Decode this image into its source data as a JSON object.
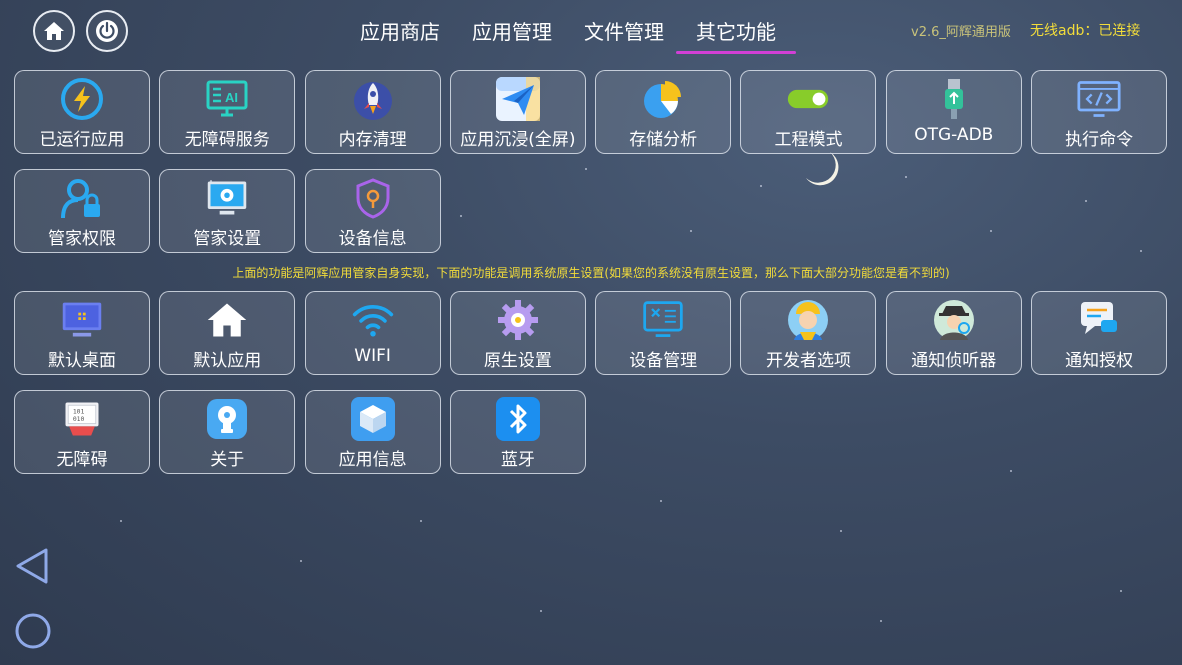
{
  "header": {
    "home_icon": "home-icon",
    "power_icon": "power-icon",
    "tabs": [
      {
        "label": "应用商店"
      },
      {
        "label": "应用管理"
      },
      {
        "label": "文件管理"
      },
      {
        "label": "其它功能",
        "active": true
      }
    ],
    "version": "v2.6_阿辉通用版",
    "adb_status": "无线adb：已连接"
  },
  "self_features": [
    {
      "label": "已运行应用",
      "icon": "lightning-icon"
    },
    {
      "label": "无障碍服务",
      "icon": "ai-monitor-icon"
    },
    {
      "label": "内存清理",
      "icon": "rocket-icon"
    },
    {
      "label": "应用沉浸(全屏)",
      "icon": "paper-plane-icon"
    },
    {
      "label": "存储分析",
      "icon": "pie-chart-icon"
    },
    {
      "label": "工程模式",
      "icon": "toggle-icon"
    },
    {
      "label": "OTG-ADB",
      "icon": "usb-icon"
    },
    {
      "label": "执行命令",
      "icon": "code-icon"
    },
    {
      "label": "管家权限",
      "icon": "user-lock-icon"
    },
    {
      "label": "管家设置",
      "icon": "monitor-gear-icon"
    },
    {
      "label": "设备信息",
      "icon": "shield-pin-icon"
    }
  ],
  "notice": "上面的功能是阿辉应用管家自身实现，下面的功能是调用系统原生设置(如果您的系统没有原生设置，那么下面大部分功能您是看不到的)",
  "system_features": [
    {
      "label": "默认桌面",
      "icon": "desktop-icon"
    },
    {
      "label": "默认应用",
      "icon": "house-icon"
    },
    {
      "label": "WIFI",
      "icon": "wifi-icon"
    },
    {
      "label": "原生设置",
      "icon": "gear-icon"
    },
    {
      "label": "设备管理",
      "icon": "device-tools-icon"
    },
    {
      "label": "开发者选项",
      "icon": "developer-avatar-icon"
    },
    {
      "label": "通知侦听器",
      "icon": "detective-icon"
    },
    {
      "label": "通知授权",
      "icon": "chat-bubbles-icon"
    },
    {
      "label": "无障碍",
      "icon": "binary-monitor-icon"
    },
    {
      "label": "关于",
      "icon": "info-chip-icon"
    },
    {
      "label": "应用信息",
      "icon": "cube-icon"
    },
    {
      "label": "蓝牙",
      "icon": "bluetooth-icon"
    }
  ],
  "nav": {
    "back_icon": "back-triangle-icon",
    "home_icon": "home-circle-icon"
  },
  "colors": {
    "accent": "#d23fd6",
    "notice": "#f2dc3a",
    "version": "#c9c37a"
  }
}
